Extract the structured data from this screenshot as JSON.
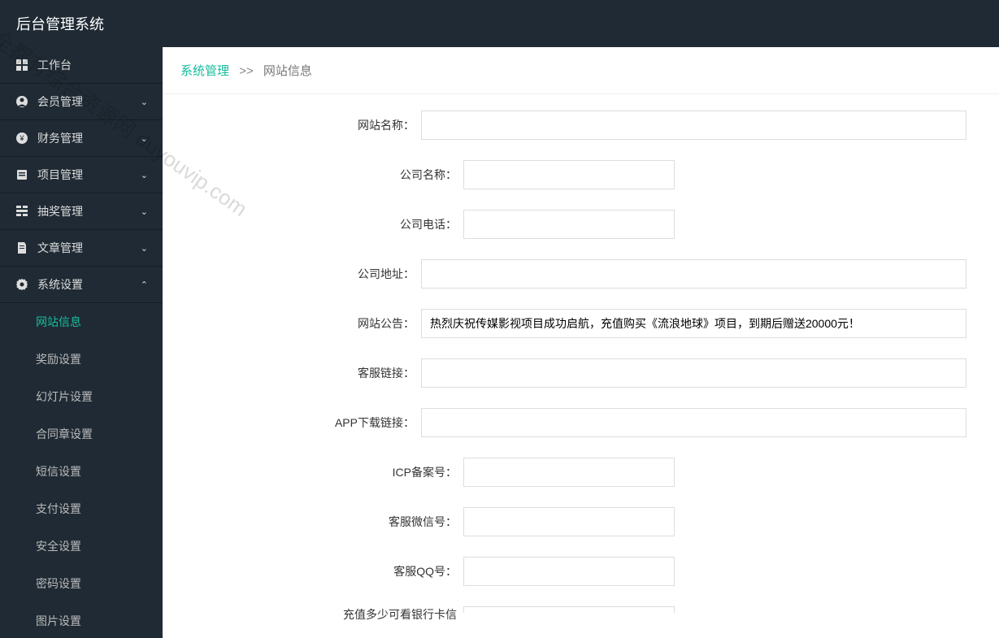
{
  "header": {
    "title": "后台管理系统"
  },
  "sidebar": {
    "items": [
      {
        "label": "工作台",
        "icon": "dashboard",
        "expandable": false
      },
      {
        "label": "会员管理",
        "icon": "user",
        "expandable": true
      },
      {
        "label": "财务管理",
        "icon": "money",
        "expandable": true
      },
      {
        "label": "项目管理",
        "icon": "project",
        "expandable": true
      },
      {
        "label": "抽奖管理",
        "icon": "lottery",
        "expandable": true
      },
      {
        "label": "文章管理",
        "icon": "article",
        "expandable": true
      },
      {
        "label": "系统设置",
        "icon": "gear",
        "expandable": true,
        "expanded": true
      }
    ],
    "subitems": [
      {
        "label": "网站信息",
        "active": true
      },
      {
        "label": "奖励设置"
      },
      {
        "label": "幻灯片设置"
      },
      {
        "label": "合同章设置"
      },
      {
        "label": "短信设置"
      },
      {
        "label": "支付设置"
      },
      {
        "label": "安全设置"
      },
      {
        "label": "密码设置"
      },
      {
        "label": "图片设置"
      }
    ]
  },
  "breadcrumb": {
    "parent": "系统管理",
    "sep": ">>",
    "current": "网站信息"
  },
  "form": {
    "fields": [
      {
        "label": "网站名称：",
        "value": "",
        "size": "full"
      },
      {
        "label": "公司名称：",
        "value": "",
        "size": "sm"
      },
      {
        "label": "公司电话：",
        "value": "",
        "size": "sm"
      },
      {
        "label": "公司地址：",
        "value": "",
        "size": "full"
      },
      {
        "label": "网站公告：",
        "value": "热烈庆祝传媒影视项目成功启航，充值购买《流浪地球》项目，到期后赠送20000元！",
        "size": "full"
      },
      {
        "label": "客服链接：",
        "value": "",
        "size": "full"
      },
      {
        "label": "APP下载链接：",
        "value": "",
        "size": "full"
      },
      {
        "label": "ICP备案号：",
        "value": "",
        "size": "sm"
      },
      {
        "label": "客服微信号：",
        "value": "",
        "size": "sm"
      },
      {
        "label": "客服QQ号：",
        "value": "",
        "size": "sm"
      },
      {
        "label": "充值多少可看银行卡信",
        "value": "",
        "size": "sm"
      }
    ]
  },
  "watermark": "全都有综合资源网  duyouvip.com"
}
